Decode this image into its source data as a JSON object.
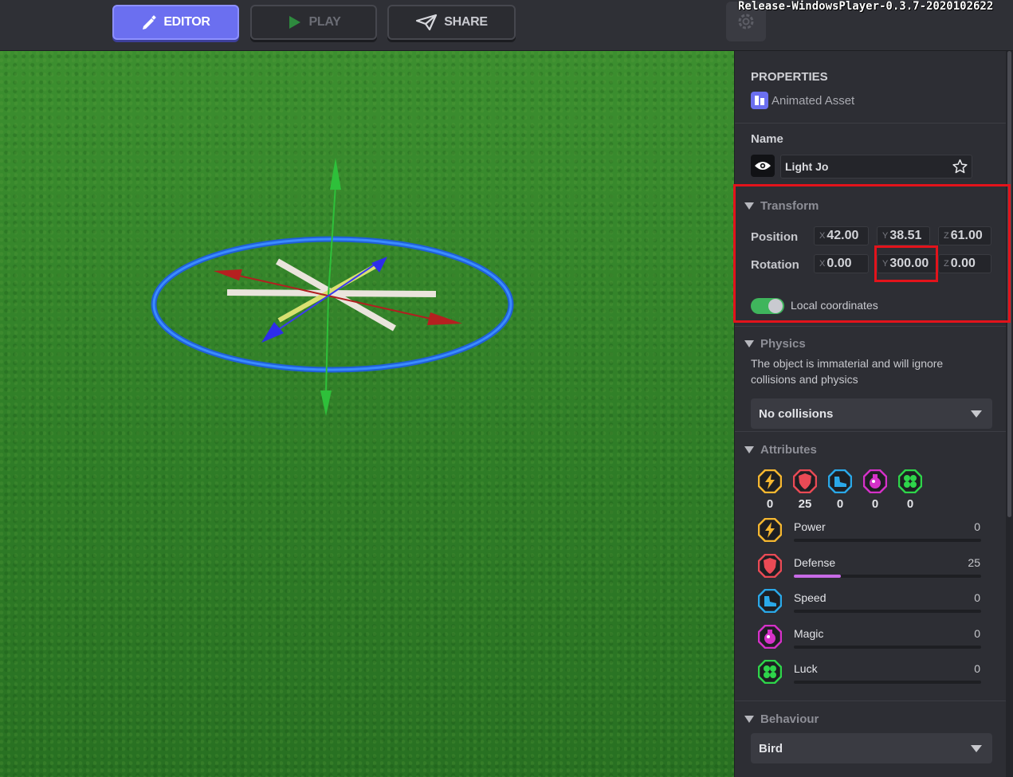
{
  "toolbar": {
    "editor_label": "EDITOR",
    "play_label": "PLAY",
    "share_label": "SHARE",
    "build_label": "Release-WindowsPlayer-0.3.7-2020102622"
  },
  "properties": {
    "header": "PROPERTIES",
    "asset_type": "Animated Asset",
    "name_label": "Name",
    "name_value": "Light Jo"
  },
  "transform": {
    "title": "Transform",
    "position_label": "Position",
    "rotation_label": "Rotation",
    "axis_x": "X",
    "axis_y": "Y",
    "axis_z": "Z",
    "position": {
      "x": "42.00",
      "y": "38.51",
      "z": "61.00"
    },
    "rotation": {
      "x": "0.00",
      "y": "300.00",
      "z": "0.00"
    },
    "local_coordinates_label": "Local coordinates",
    "local_coordinates_on": true
  },
  "physics": {
    "title": "Physics",
    "description": "The object is immaterial and will ignore collisions and physics",
    "selected": "No collisions"
  },
  "attributes": {
    "title": "Attributes",
    "colors": {
      "power": "#f5b730",
      "defense": "#e94a55",
      "speed": "#2aa8e8",
      "magic": "#d531c8",
      "luck": "#2ed44a",
      "defense_fill": "#c76ae6"
    },
    "summary": [
      {
        "icon": "lightning-icon",
        "count": "0"
      },
      {
        "icon": "shield-icon",
        "count": "25"
      },
      {
        "icon": "boot-icon",
        "count": "0"
      },
      {
        "icon": "potion-icon",
        "count": "0"
      },
      {
        "icon": "clover-icon",
        "count": "0"
      }
    ],
    "items": [
      {
        "name": "Power",
        "value": "0",
        "level": 0
      },
      {
        "name": "Defense",
        "value": "25",
        "level": 0.25
      },
      {
        "name": "Speed",
        "value": "0",
        "level": 0
      },
      {
        "name": "Magic",
        "value": "0",
        "level": 0
      },
      {
        "name": "Luck",
        "value": "0",
        "level": 0
      }
    ]
  },
  "behaviour": {
    "title": "Behaviour",
    "selected": "Bird"
  }
}
